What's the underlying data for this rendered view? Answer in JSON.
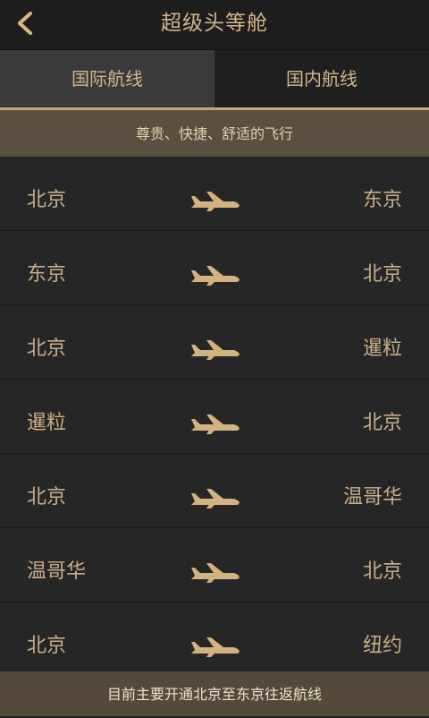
{
  "header": {
    "title": "超级头等舱",
    "back_icon": "back-arrow-icon"
  },
  "tabs": [
    {
      "label": "国际航线",
      "active": true
    },
    {
      "label": "国内航线",
      "active": false
    }
  ],
  "banner": {
    "text": "尊贵、快捷、舒适的飞行"
  },
  "routes": [
    {
      "from": "北京",
      "to": "东京"
    },
    {
      "from": "东京",
      "to": "北京"
    },
    {
      "from": "北京",
      "to": "暹粒"
    },
    {
      "from": "暹粒",
      "to": "北京"
    },
    {
      "from": "北京",
      "to": "温哥华"
    },
    {
      "from": "温哥华",
      "to": "北京"
    },
    {
      "from": "北京",
      "to": "纽约"
    }
  ],
  "footer": {
    "text": "目前主要开通北京至东京往返航线"
  },
  "colors": {
    "accent": "#c9a574",
    "background": "#262626",
    "banner": "#5a5040"
  }
}
